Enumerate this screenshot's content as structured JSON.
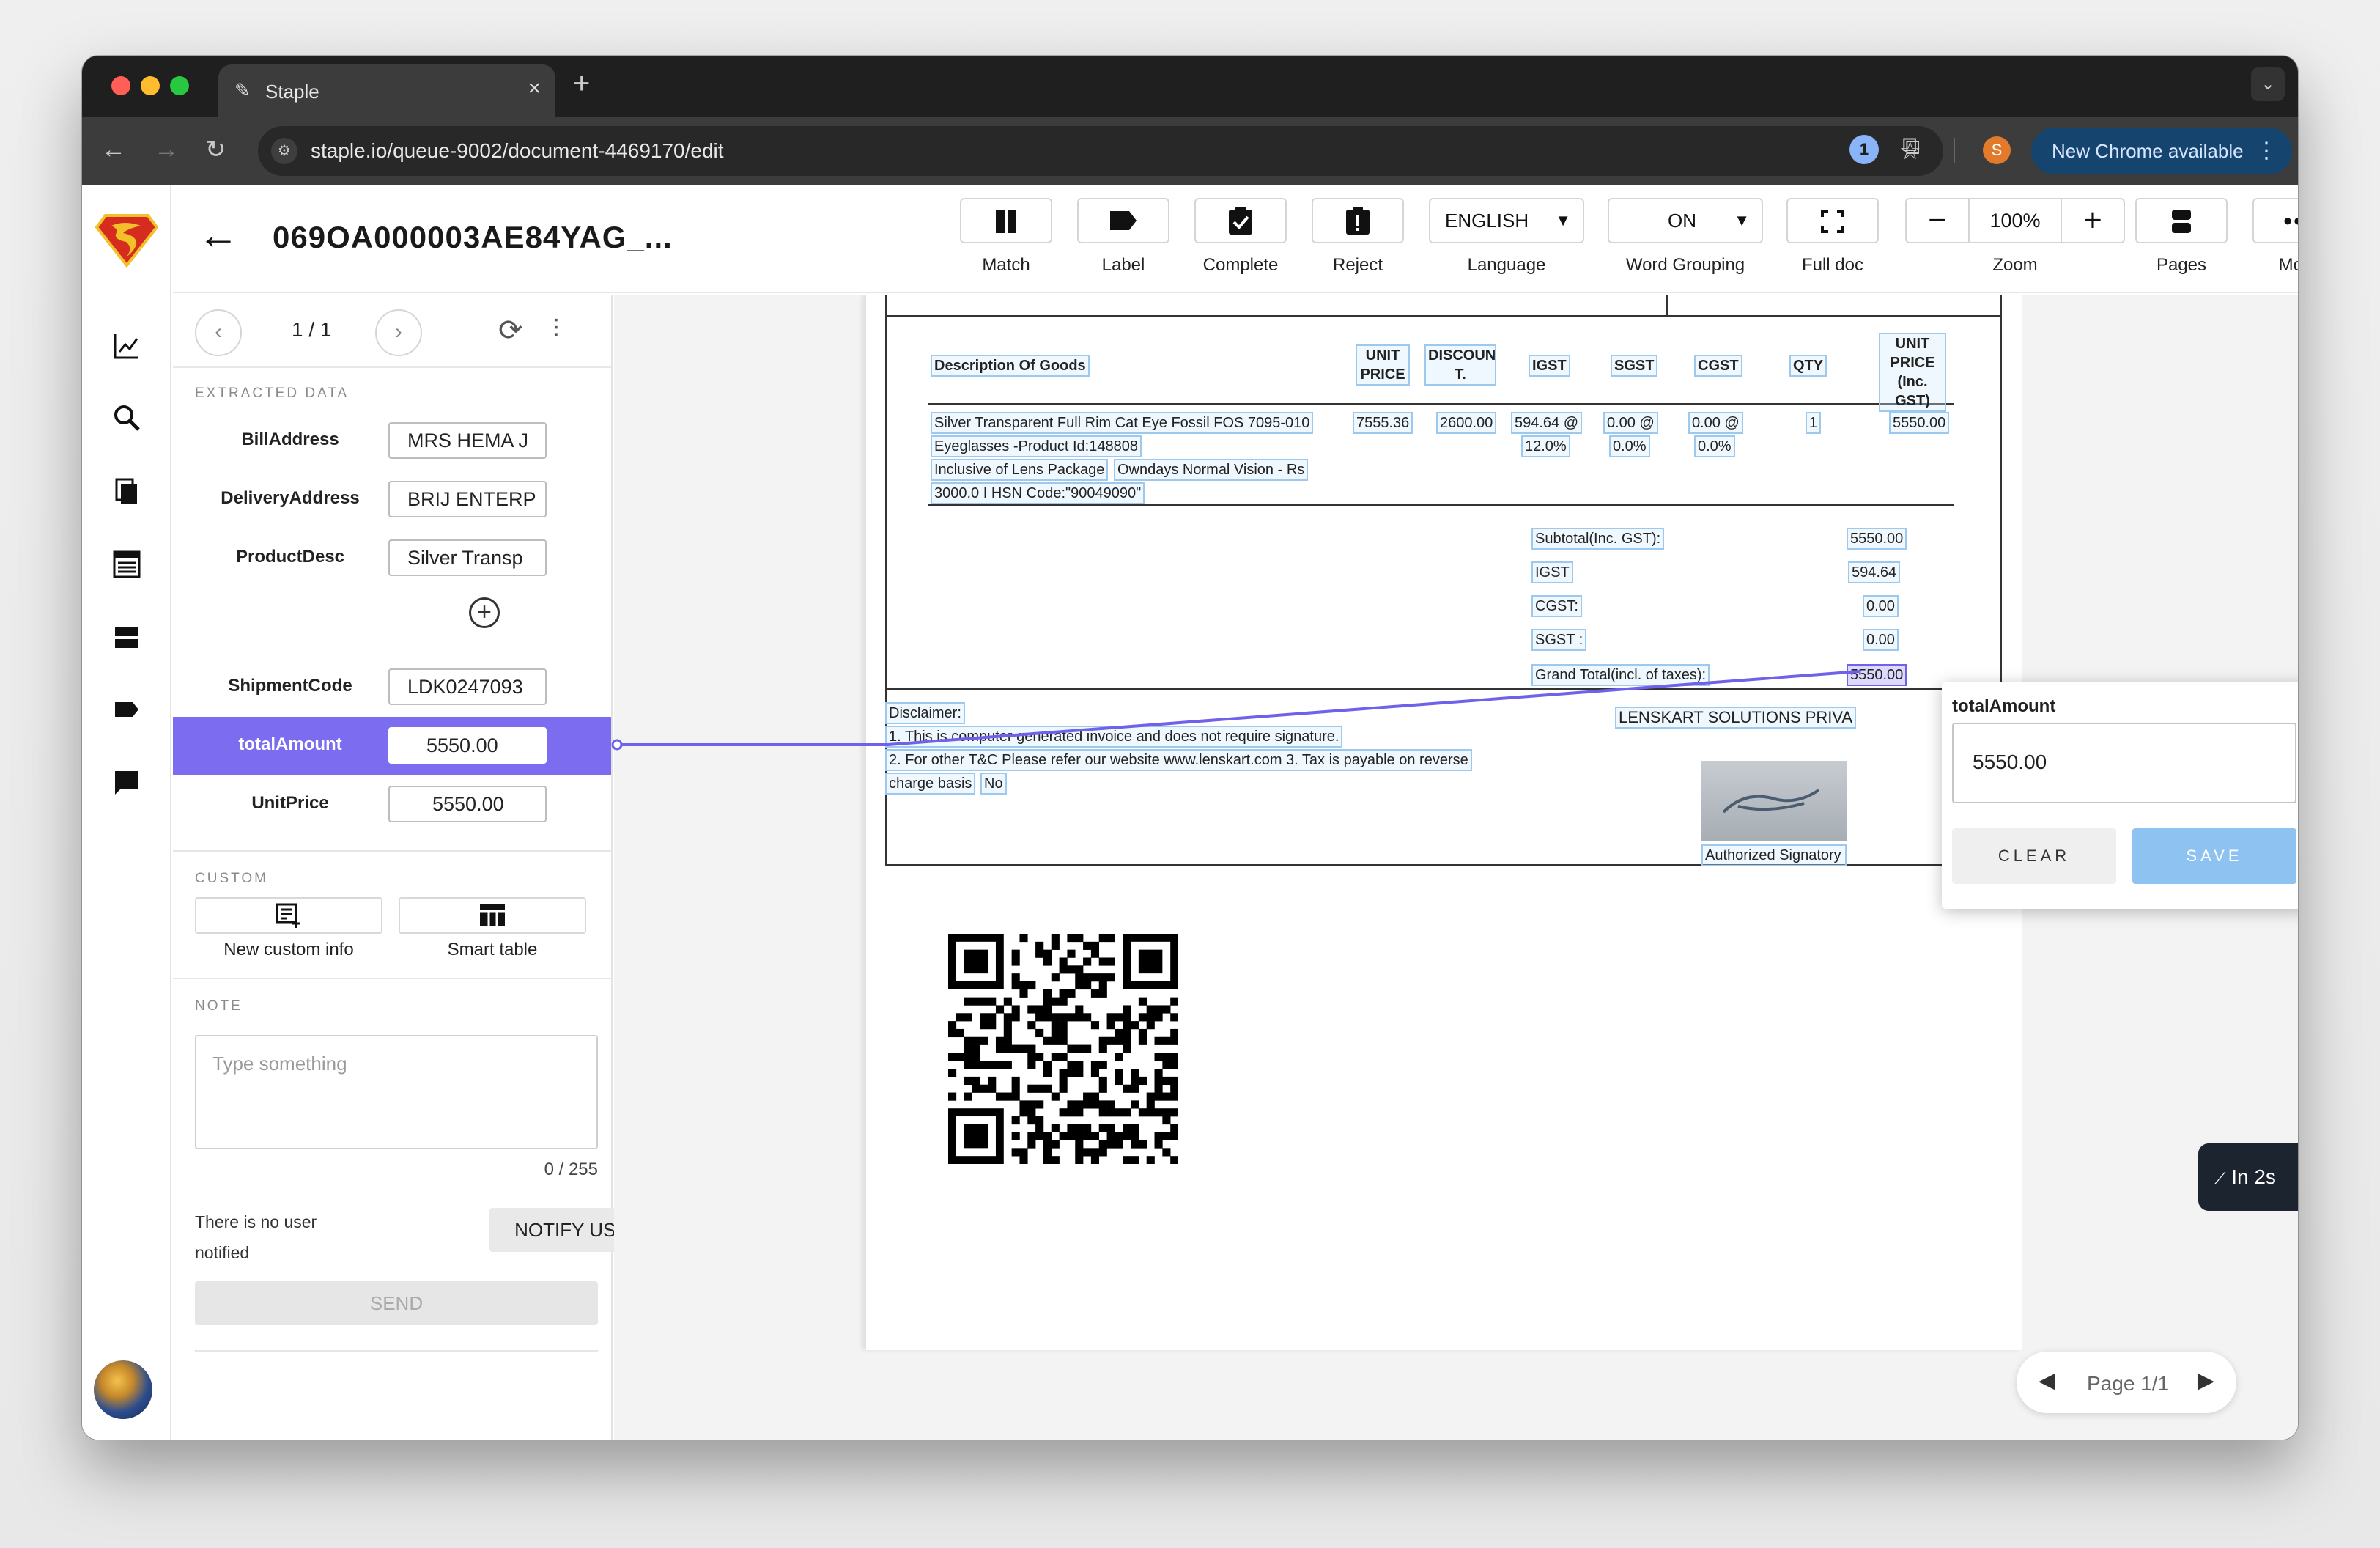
{
  "browser": {
    "tab_title": "Staple",
    "url": "staple.io/queue-9002/document-4469170/edit",
    "update_label": "New Chrome available",
    "profile_initial": "S",
    "colors": {
      "tab_bar": "#1f1f1f",
      "toolbar": "#3c3c3c",
      "update_pill": "#15446e"
    }
  },
  "header": {
    "doc_title": "069OA000003AE84YAG_...",
    "toolbar": [
      {
        "icon": "match-icon",
        "label": "Match"
      },
      {
        "icon": "label-icon",
        "label": "Label"
      },
      {
        "icon": "complete-icon",
        "label": "Complete"
      },
      {
        "icon": "reject-icon",
        "label": "Reject"
      }
    ],
    "language": {
      "value": "ENGLISH",
      "label": "Language"
    },
    "word_grouping": {
      "value": "ON",
      "label": "Word Grouping"
    },
    "full_doc_label": "Full doc",
    "zoom": {
      "value": "100%",
      "label": "Zoom"
    },
    "pages_label": "Pages",
    "more_label": "More"
  },
  "panel": {
    "pager": "1 / 1",
    "extracted_heading": "EXTRACTED DATA",
    "fields": [
      {
        "label": "BillAddress",
        "value": "MRS HEMA J"
      },
      {
        "label": "DeliveryAddress",
        "value": "BRIJ ENTERP"
      },
      {
        "label": "ProductDesc",
        "value": "Silver Transp"
      },
      {
        "label": "ShipmentCode",
        "value": "LDK0247093"
      },
      {
        "label": "totalAmount",
        "value": "5550.00"
      },
      {
        "label": "UnitPrice",
        "value": "5550.00"
      }
    ],
    "custom_heading": "CUSTOM",
    "new_custom_label": "New custom info",
    "smart_table_label": "Smart table",
    "note_heading": "NOTE",
    "note_placeholder": "Type something",
    "note_count": "0 / 255",
    "no_user_text": "There is no user notified",
    "notify_label": "NOTIFY USERS",
    "send_label": "SEND",
    "active_color": "#7b6cf0"
  },
  "document": {
    "headers": [
      "Description Of Goods",
      "UNIT PRICE",
      "DISCOUN T.",
      "IGST",
      "SGST",
      "CGST",
      "QTY",
      "UNIT PRICE (Inc. GST)"
    ],
    "item": {
      "line1": "Silver Transparent Full Rim Cat Eye Fossil FOS 7095-010",
      "line2": "Eyeglasses -Product Id:148808",
      "line3a": "Inclusive of Lens Package",
      "line3b": "Owndays Normal Vision - Rs",
      "line4": "3000.0 I HSN Code:\"90049090\"",
      "unit_price": "7555.36",
      "discount": "2600.00",
      "igst": "594.64 @",
      "igst_rate": "12.0%",
      "sgst": "0.00 @",
      "sgst_rate": "0.0%",
      "cgst": "0.00 @",
      "cgst_rate": "0.0%",
      "qty": "1",
      "unit_price_gst": "5550.00"
    },
    "totals": [
      {
        "label": "Subtotal(Inc. GST):",
        "value": "5550.00"
      },
      {
        "label": "IGST",
        "value": "594.64"
      },
      {
        "label": "CGST:",
        "value": "0.00"
      },
      {
        "label": "SGST :",
        "value": "0.00"
      },
      {
        "label": "Grand Total(incl. of taxes):",
        "value": "5550.00"
      }
    ],
    "disclaimer": "Disclaimer:",
    "disclaimer1": "1. This is computer generated invoice and does not require signature.",
    "disclaimer2": "2. For other T&C Please refer our website www.lenskart.com 3. Tax is payable on reverse",
    "charge_basis": "charge basis",
    "charge_no": "No",
    "company": "LENSKART SOLUTIONS PRIVA",
    "signatory": "Authorized Signatory"
  },
  "popup": {
    "title": "totalAmount",
    "value": "5550.00",
    "clear_label": "CLEAR",
    "save_label": "SAVE"
  },
  "toast": "In 2s",
  "page_nav": "Page 1/1"
}
